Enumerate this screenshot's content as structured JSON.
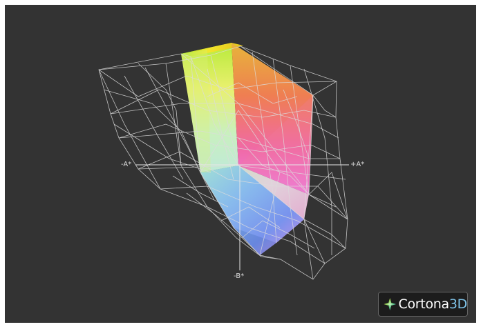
{
  "viewer": {
    "background_color": "#333333",
    "wire_color": "#dcdcdc"
  },
  "axes": {
    "plus_a_label": "+A*",
    "minus_a_label": "-A*",
    "minus_b_label": "-B*"
  },
  "logo": {
    "brand_main": "Cortona",
    "brand_accent": "3D",
    "icon": "cortona-star-icon"
  }
}
